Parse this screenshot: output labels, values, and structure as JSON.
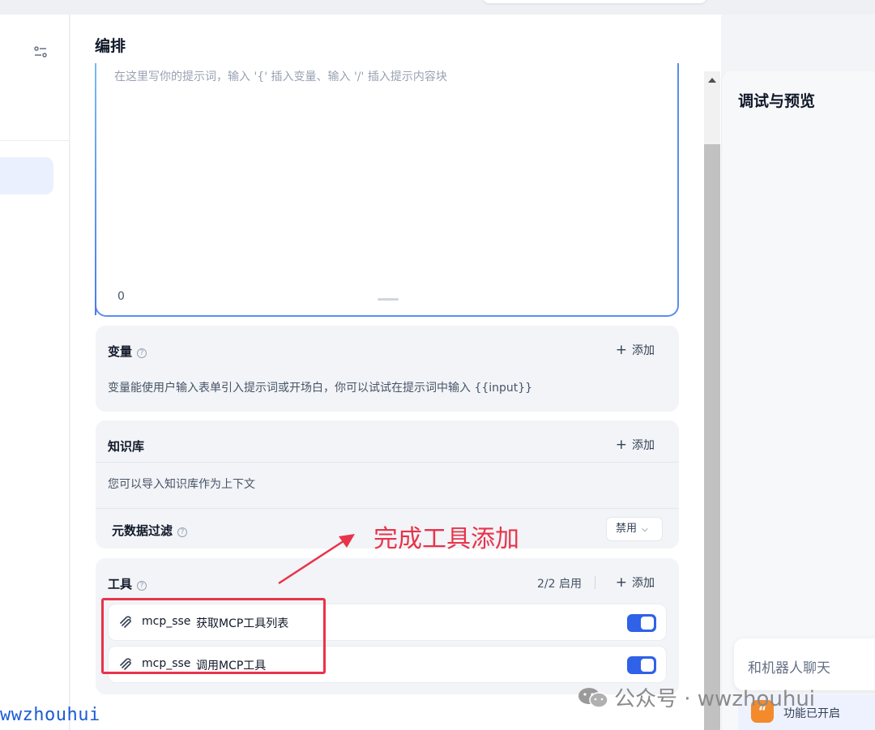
{
  "main": {
    "title": "编排",
    "prompt": {
      "placeholder": "在这里写你的提示词，输入 '{' 插入变量、输入 '/' 插入提示内容块",
      "char_count": "0"
    },
    "variables": {
      "title": "变量",
      "add_label": "添加",
      "description": "变量能使用户输入表单引入提示词或开场白，你可以试试在提示词中输入 {{input}}"
    },
    "knowledge": {
      "title": "知识库",
      "add_label": "添加",
      "description": "您可以导入知识库作为上下文",
      "metadata_filter_label": "元数据过滤",
      "metadata_filter_value": "禁用"
    },
    "tools": {
      "title": "工具",
      "enabled_count": "2/2 启用",
      "add_label": "添加",
      "items": [
        {
          "name": "mcp_sse",
          "description": "获取MCP工具列表",
          "enabled": true
        },
        {
          "name": "mcp_sse",
          "description": "调用MCP工具",
          "enabled": true
        }
      ]
    }
  },
  "annotation": {
    "text": "完成工具添加",
    "color": "#e8334a"
  },
  "right_panel": {
    "title": "调试与预览",
    "chat_placeholder": "和机器人聊天",
    "feature_label": "功能已开启"
  },
  "watermarks": {
    "left": "wwzhouhui",
    "right": "公众号 · wwzhouhui"
  },
  "colors": {
    "accent": "#2f62e8",
    "annotation": "#e8334a",
    "feature_icon": "#f38a2c"
  }
}
